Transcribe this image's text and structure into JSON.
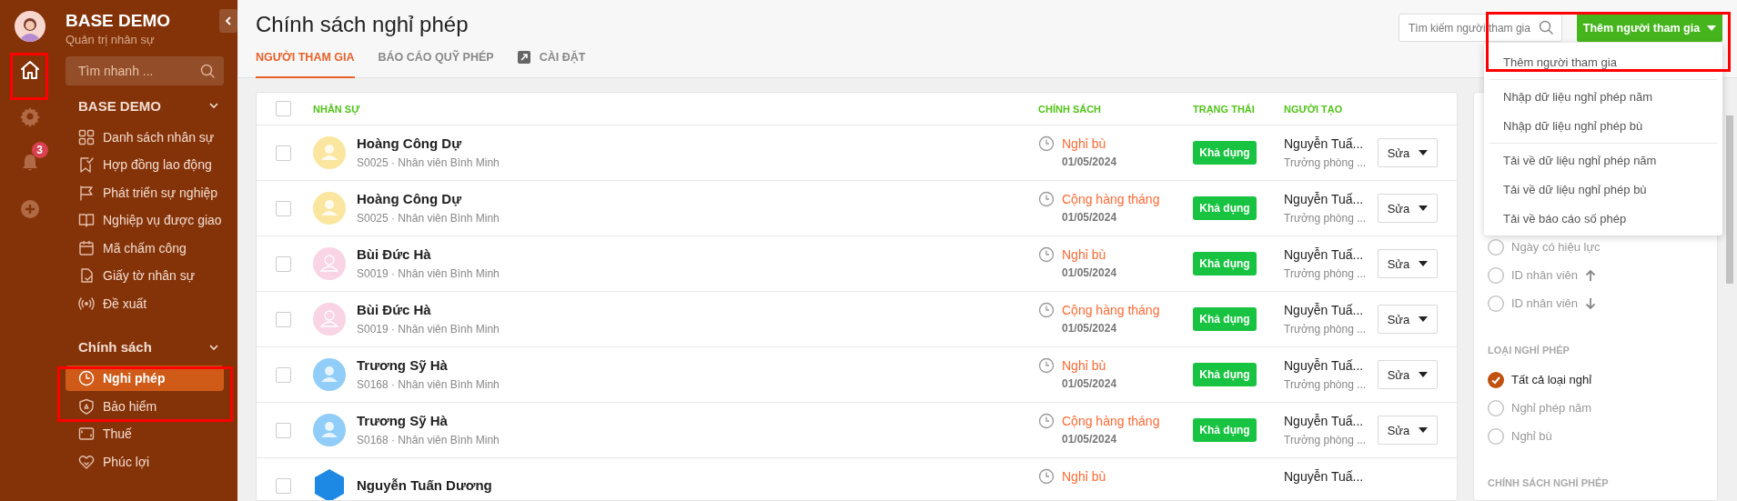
{
  "rail": {
    "items": [
      {
        "selected": true
      },
      {
        "selected": false
      },
      {
        "selected": false,
        "badge": "3"
      },
      {
        "selected": false
      }
    ]
  },
  "sidebar": {
    "title": "BASE DEMO",
    "subtitle": "Quản trị nhân sự",
    "search": {
      "placeholder": "Tìm nhanh ..."
    },
    "sections": [
      {
        "title": "BASE DEMO",
        "expanded": true,
        "items": [
          {
            "label": "Danh sách nhân sự",
            "selected": false
          },
          {
            "label": "Hợp đồng lao động",
            "selected": false
          },
          {
            "label": "Phát triển sự nghiệp",
            "selected": false
          },
          {
            "label": "Nghiệp vụ được giao",
            "selected": false
          },
          {
            "label": "Mã chấm công",
            "selected": false
          },
          {
            "label": "Giấy tờ nhân sự",
            "selected": false
          },
          {
            "label": "Đề xuất",
            "selected": false
          }
        ]
      },
      {
        "title": "Chính sách",
        "expanded": true,
        "items": [
          {
            "label": "Nghỉ phép",
            "selected": true
          },
          {
            "label": "Bảo hiểm",
            "selected": false
          },
          {
            "label": "Thuế",
            "selected": false
          },
          {
            "label": "Phúc lợi",
            "selected": false
          }
        ]
      }
    ]
  },
  "page": {
    "title": "Chính sách nghỉ phép",
    "tabs": [
      {
        "label": "NGƯỜI THAM GIA",
        "selected": true
      },
      {
        "label": "BÁO CÁO QUỸ PHÉP",
        "selected": false
      },
      {
        "label": "CÀI ĐẶT",
        "selected": false,
        "kind": "external"
      }
    ],
    "search": {
      "placeholder": "Tìm kiếm người tham gia"
    },
    "add_button": {
      "label": "Thêm người tham gia"
    },
    "menu": [
      {
        "label": "Thêm người tham gia",
        "divider_before": false
      },
      {
        "label": "Nhập dữ liệu nghỉ phép năm",
        "divider_before": true
      },
      {
        "label": "Nhập dữ liệu nghỉ phép bù",
        "divider_before": false
      },
      {
        "label": "Tải về dữ liệu nghỉ phép năm",
        "divider_before": true
      },
      {
        "label": "Tải về dữ liệu nghỉ phép bù",
        "divider_before": false
      },
      {
        "label": "Tải về báo cáo số phép",
        "divider_before": false
      }
    ]
  },
  "table": {
    "all_checked": false,
    "columns": [
      "NHÂN SỰ",
      "CHÍNH SÁCH",
      "TRẠNG THÁI",
      "NGƯỜI TẠO"
    ],
    "rows": [
      {
        "checked": false,
        "name": "Hoàng Công Dự",
        "detail": "S0025 · Nhân viên Bình Minh",
        "avatar": {
          "kind": "filled",
          "color": "#fbe6a0"
        },
        "policy": "Nghỉ bù",
        "date": "01/05/2024",
        "status": "Khả dụng",
        "creator": "Nguyễn Tuấ...",
        "creator_role": "Trưởng phòng ...",
        "action": "Sửa"
      },
      {
        "checked": false,
        "name": "Hoàng Công Dự",
        "detail": "S0025 · Nhân viên Bình Minh",
        "avatar": {
          "kind": "filled",
          "color": "#fbe6a0"
        },
        "policy": "Cộng hàng tháng",
        "date": "01/05/2024",
        "status": "Khả dụng",
        "creator": "Nguyễn Tuấ...",
        "creator_role": "Trưởng phòng ...",
        "action": "Sửa"
      },
      {
        "checked": false,
        "name": "Bùi Đức Hà",
        "detail": "S0019 · Nhân viên Bình Minh",
        "avatar": {
          "kind": "outline",
          "color": "#f8d4e4"
        },
        "policy": "Nghỉ bù",
        "date": "01/05/2024",
        "status": "Khả dụng",
        "creator": "Nguyễn Tuấ...",
        "creator_role": "Trưởng phòng ...",
        "action": "Sửa"
      },
      {
        "checked": false,
        "name": "Bùi Đức Hà",
        "detail": "S0019 · Nhân viên Bình Minh",
        "avatar": {
          "kind": "outline",
          "color": "#f8d4e4"
        },
        "policy": "Cộng hàng tháng",
        "date": "01/05/2024",
        "status": "Khả dụng",
        "creator": "Nguyễn Tuấ...",
        "creator_role": "Trưởng phòng ...",
        "action": "Sửa"
      },
      {
        "checked": false,
        "name": "Trương Sỹ Hà",
        "detail": "S0168 · Nhân viên Bình Minh",
        "avatar": {
          "kind": "filled",
          "color": "#90cdf8"
        },
        "policy": "Nghỉ bù",
        "date": "01/05/2024",
        "status": "Khả dụng",
        "creator": "Nguyễn Tuấ...",
        "creator_role": "Trưởng phòng ...",
        "action": "Sửa"
      },
      {
        "checked": false,
        "name": "Trương Sỹ Hà",
        "detail": "S0168 · Nhân viên Bình Minh",
        "avatar": {
          "kind": "filled",
          "color": "#90cdf8"
        },
        "policy": "Cộng hàng tháng",
        "date": "01/05/2024",
        "status": "Khả dụng",
        "creator": "Nguyễn Tuấ...",
        "creator_role": "Trưởng phòng ...",
        "action": "Sửa"
      },
      {
        "checked": false,
        "name": "Nguyễn Tuấn Dương",
        "avatar": {
          "kind": "hexagon",
          "color": "#1e88e5"
        },
        "policy": "Nghỉ bù",
        "creator": "Nguyễn Tuấ..."
      }
    ]
  },
  "filters": {
    "sort": [
      {
        "label": "Ngày có hiệu lực",
        "checked": false,
        "kind": "plain"
      },
      {
        "label": "ID nhân viên",
        "checked": false,
        "kind": "ascending"
      },
      {
        "label": "ID nhân viên",
        "checked": false,
        "kind": "descending"
      }
    ],
    "groups": [
      {
        "title": "LOẠI NGHỈ PHÉP",
        "options": [
          {
            "label": "Tất cả loại nghỉ",
            "checked": true
          },
          {
            "label": "Nghỉ phép năm",
            "checked": false
          },
          {
            "label": "Nghỉ bù",
            "checked": false
          }
        ]
      },
      {
        "title": "CHÍNH SÁCH NGHỈ PHÉP"
      }
    ]
  }
}
